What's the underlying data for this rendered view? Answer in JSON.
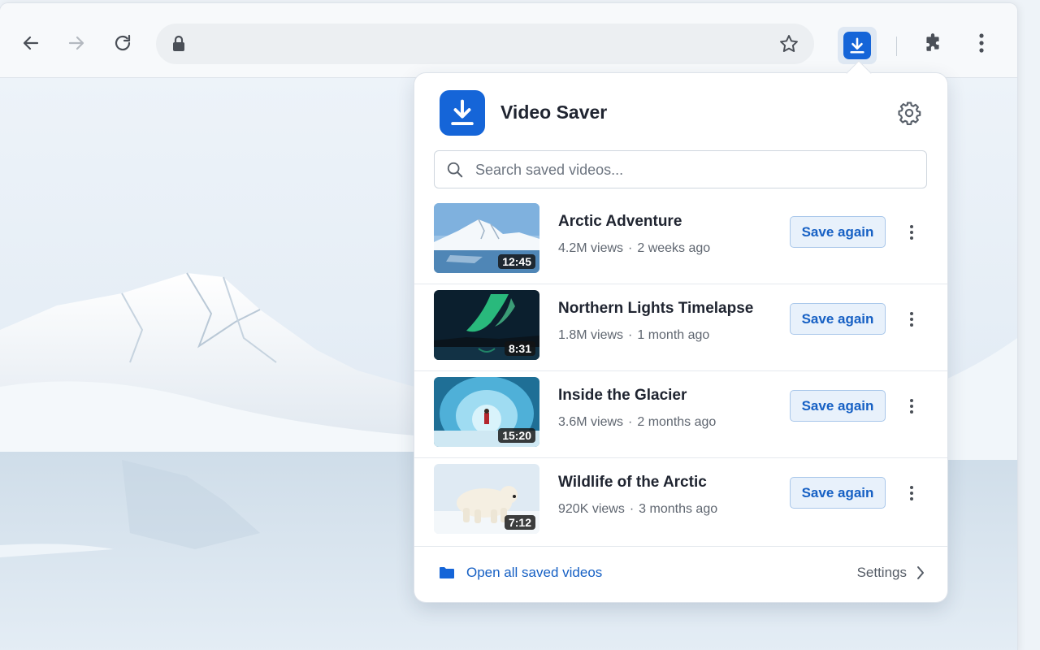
{
  "browser": {
    "address": "",
    "icons": [
      "back-arrow-icon",
      "forward-arrow-icon",
      "reload-icon",
      "lock-icon",
      "star-icon",
      "download-icon",
      "puzzle-icon",
      "kebab-icon"
    ]
  },
  "popup": {
    "title": "Video Saver",
    "search_placeholder": "Search saved videos...",
    "save_label": "Save again",
    "videos": [
      {
        "title": "Arctic Adventure",
        "views": "4.2M views",
        "age": "2 weeks ago",
        "duration": "12:45"
      },
      {
        "title": "Northern Lights Timelapse",
        "views": "1.8M views",
        "age": "1 month ago",
        "duration": "8:31"
      },
      {
        "title": "Inside the Glacier",
        "views": "3.6M views",
        "age": "2 months ago",
        "duration": "15:20"
      },
      {
        "title": "Wildlife of the Arctic",
        "views": "920K views",
        "age": "3 months ago",
        "duration": "7:12"
      }
    ],
    "footer": {
      "open_all": "Open all saved videos",
      "settings": "Settings"
    }
  },
  "colors": {
    "accent": "#1565d8",
    "link": "#1660c4",
    "button_bg": "#e8f1fb"
  }
}
